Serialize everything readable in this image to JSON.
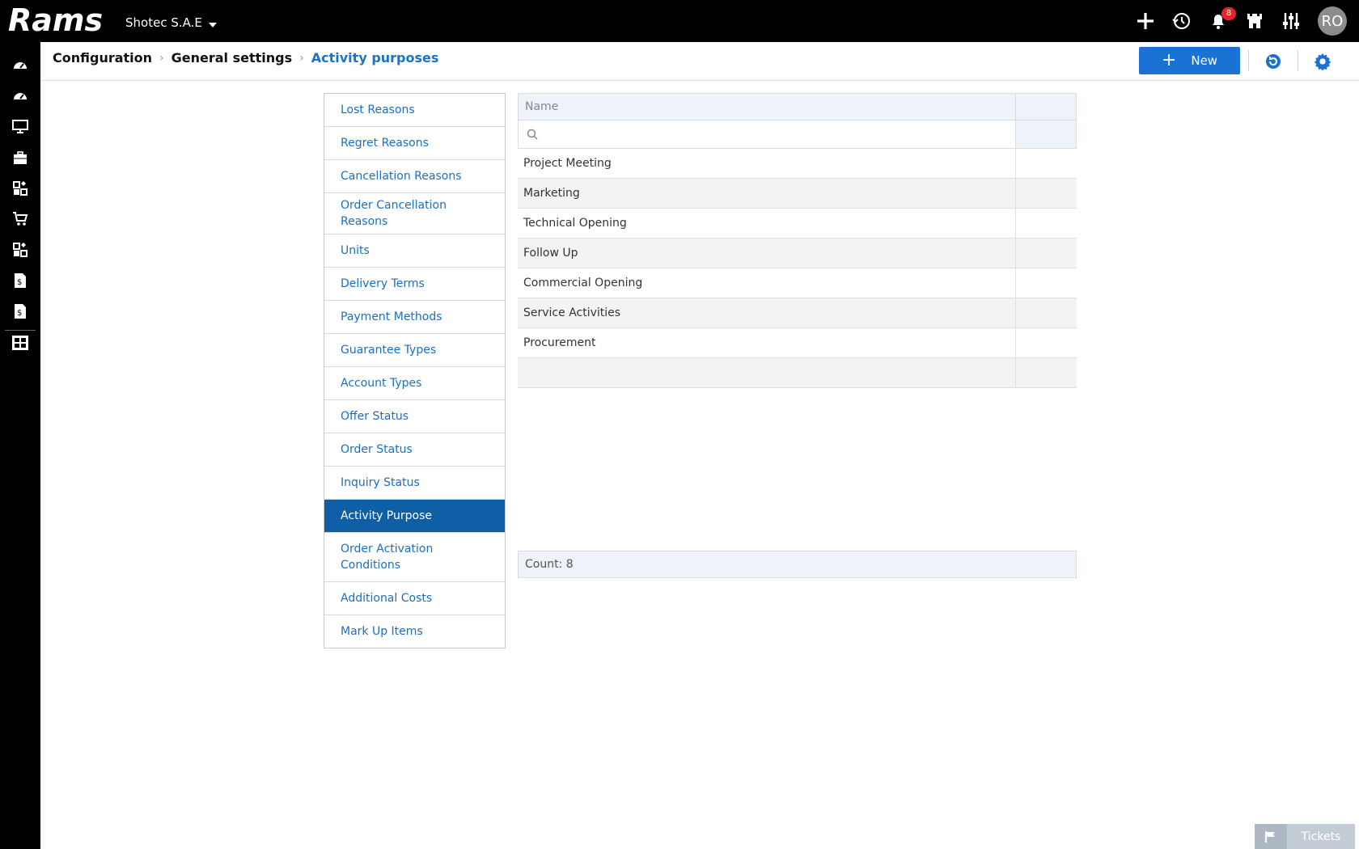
{
  "app": {
    "logo_text": "Rams",
    "company": "Shotec S.A.E",
    "notifications_count": "8",
    "user_initials": "RO"
  },
  "top_icons": [
    "plus-icon",
    "history-icon",
    "bell-icon",
    "castle-icon",
    "sliders-icon"
  ],
  "rail_icons": [
    "dashboard-icon",
    "dashboard-2-icon",
    "monitor-icon",
    "briefcase-icon",
    "modules-icon",
    "cart-icon",
    "modules-2-icon",
    "invoice-icon",
    "invoice-2-icon",
    "board-icon"
  ],
  "breadcrumb": {
    "items": [
      "Configuration",
      "General settings",
      "Activity purposes"
    ]
  },
  "toolbar": {
    "new_label": "New"
  },
  "settings_list": [
    "Lost Reasons",
    "Regret Reasons",
    "Cancellation Reasons",
    "Order Cancellation Reasons",
    "Units",
    "Delivery Terms",
    "Payment Methods",
    "Guarantee Types",
    "Account Types",
    "Offer Status",
    "Order Status",
    "Inquiry Status",
    "Activity Purpose",
    "Order Activation Conditions",
    "Additional Costs",
    "Mark Up Items"
  ],
  "settings_active": "Activity Purpose",
  "grid": {
    "column_name": "Name",
    "search_placeholder": "",
    "rows": [
      "Project Meeting",
      "Marketing",
      "Technical Opening",
      "Follow Up",
      "Commercial Opening",
      "Service Activities",
      "Procurement",
      ""
    ],
    "count_text": "Count: 8"
  },
  "tickets_label": "Tickets",
  "colors": {
    "primary": "#1a73d4",
    "active_item": "#0f5fa7",
    "link": "#1a6fc4",
    "badge": "#e5252b"
  }
}
